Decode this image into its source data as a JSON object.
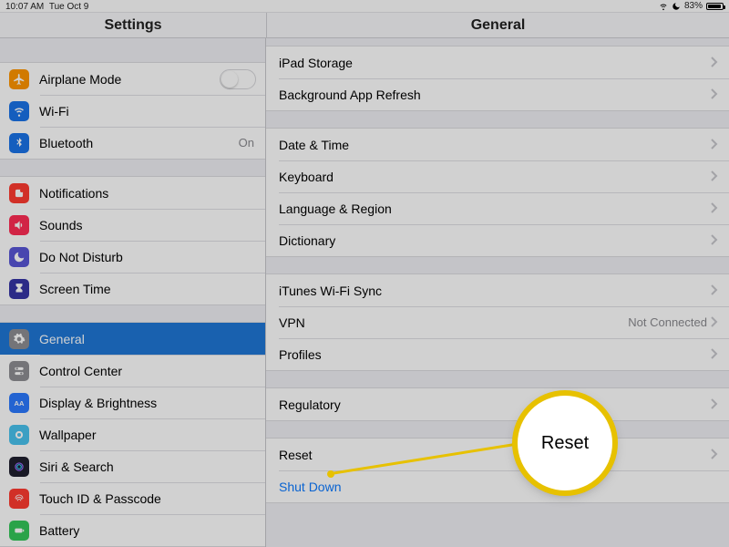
{
  "status": {
    "time": "10:07 AM",
    "date": "Tue Oct 9",
    "battery_pct": "83%"
  },
  "titles": {
    "sidebar": "Settings",
    "detail": "General"
  },
  "sidebar": {
    "g1": [
      {
        "label": "Airplane Mode"
      },
      {
        "label": "Wi-Fi",
        "value": ""
      },
      {
        "label": "Bluetooth",
        "value": "On"
      }
    ],
    "g2": [
      {
        "label": "Notifications"
      },
      {
        "label": "Sounds"
      },
      {
        "label": "Do Not Disturb"
      },
      {
        "label": "Screen Time"
      }
    ],
    "g3": [
      {
        "label": "General"
      },
      {
        "label": "Control Center"
      },
      {
        "label": "Display & Brightness"
      },
      {
        "label": "Wallpaper"
      },
      {
        "label": "Siri & Search"
      },
      {
        "label": "Touch ID & Passcode"
      },
      {
        "label": "Battery"
      }
    ]
  },
  "detail": {
    "g1": [
      {
        "label": "iPad Storage"
      },
      {
        "label": "Background App Refresh"
      }
    ],
    "g2": [
      {
        "label": "Date & Time"
      },
      {
        "label": "Keyboard"
      },
      {
        "label": "Language & Region"
      },
      {
        "label": "Dictionary"
      }
    ],
    "g3": [
      {
        "label": "iTunes Wi-Fi Sync"
      },
      {
        "label": "VPN",
        "value": "Not Connected"
      },
      {
        "label": "Profiles"
      }
    ],
    "g4": [
      {
        "label": "Regulatory"
      }
    ],
    "g5": [
      {
        "label": "Reset"
      },
      {
        "label": "Shut Down"
      }
    ]
  },
  "annotation": {
    "callout_text": "Reset"
  }
}
